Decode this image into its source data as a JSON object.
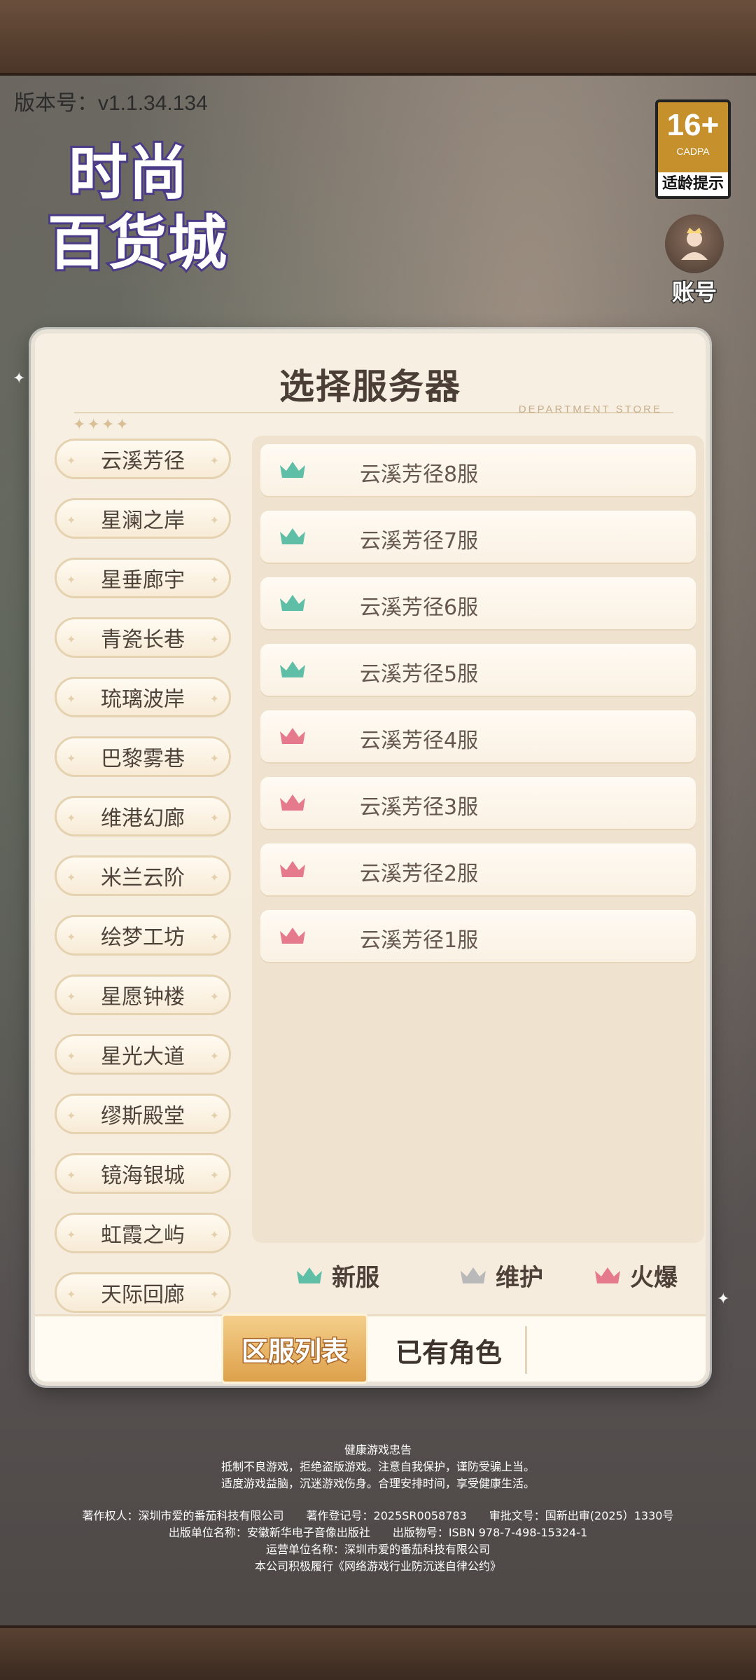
{
  "version": "版本号：v1.1.34.134",
  "logo": {
    "line1": "时尚",
    "line2": "百货城"
  },
  "age_rating": {
    "age": "16+",
    "org": "CADPA",
    "tip": "适龄提示"
  },
  "account": {
    "label": "账号"
  },
  "dialog": {
    "title": "选择服务器",
    "subtitle": "DEPARTMENT STORE",
    "stars": "✦✦✦✦",
    "regions": [
      "云溪芳径",
      "星澜之岸",
      "星垂廊宇",
      "青瓷长巷",
      "琉璃波岸",
      "巴黎雾巷",
      "维港幻廊",
      "米兰云阶",
      "绘梦工坊",
      "星愿钟楼",
      "星光大道",
      "缪斯殿堂",
      "镜海银城",
      "虹霞之屿",
      "天际回廊"
    ],
    "servers": [
      {
        "name": "云溪芳径8服",
        "status": "new"
      },
      {
        "name": "云溪芳径7服",
        "status": "new"
      },
      {
        "name": "云溪芳径6服",
        "status": "new"
      },
      {
        "name": "云溪芳径5服",
        "status": "new"
      },
      {
        "name": "云溪芳径4服",
        "status": "hot"
      },
      {
        "name": "云溪芳径3服",
        "status": "hot"
      },
      {
        "name": "云溪芳径2服",
        "status": "hot"
      },
      {
        "name": "云溪芳径1服",
        "status": "hot"
      }
    ],
    "legend": {
      "new": "新服",
      "maintenance": "维护",
      "hot": "火爆"
    },
    "tabs": {
      "server_list": "区服列表",
      "my_roles": "已有角色"
    }
  },
  "colors": {
    "new": "#5fbfa6",
    "maintenance": "#b9b9b9",
    "hot": "#e47a8c"
  },
  "health_notice": {
    "title": "健康游戏忠告",
    "line1": "抵制不良游戏，拒绝盗版游戏。注意自我保护，谨防受骗上当。",
    "line2": "适度游戏益脑，沉迷游戏伤身。合理安排时间，享受健康生活。"
  },
  "copyright": {
    "line1": "著作权人：深圳市爱的番茄科技有限公司　　著作登记号：2025SR0058783　　审批文号：国新出审(2025）1330号",
    "line2": "出版单位名称：安徽新华电子音像出版社　　出版物号：ISBN 978-7-498-15324-1",
    "line3": "运营单位名称：深圳市爱的番茄科技有限公司",
    "line4": "本公司积极履行《网络游戏行业防沉迷自律公约》"
  }
}
